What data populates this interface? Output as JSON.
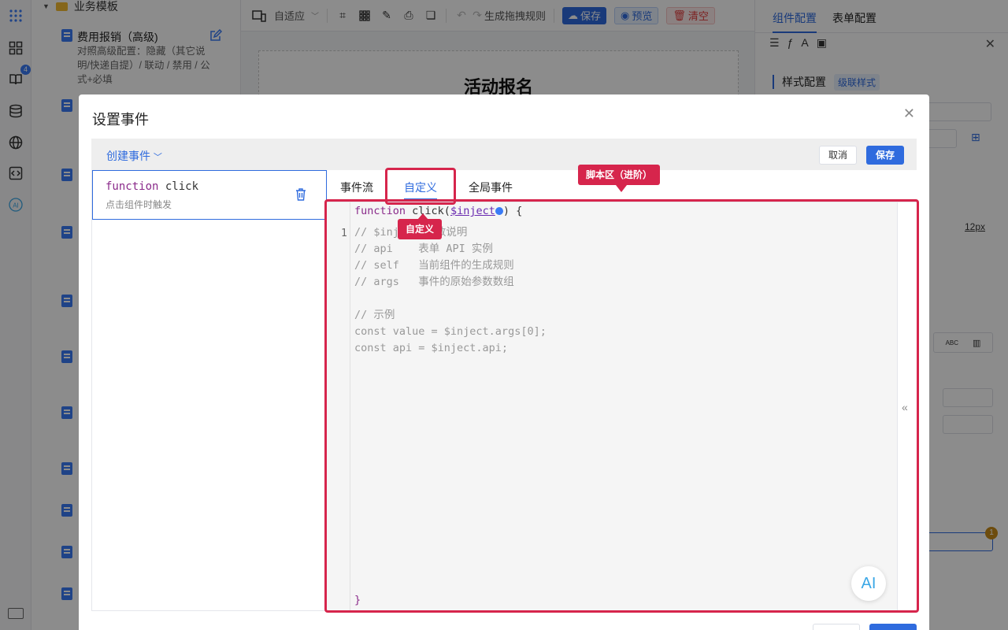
{
  "tree": {
    "root_label": "业务模板",
    "item_title": "费用报销（高级)",
    "item_desc": "对照高级配置：隐藏（其它说明/快递自提）/ 联动 / 禁用 / 公式+必填"
  },
  "rail": {
    "badge_count": "4",
    "ai_label": "AI"
  },
  "toolbar": {
    "mode_label": "自适应",
    "rules_label": "生成拖拽规则",
    "save_label": "保存",
    "preview_label": "预览",
    "clear_label": "清空"
  },
  "canvas": {
    "form_title": "活动报名"
  },
  "config": {
    "tab_component": "组件配置",
    "tab_form": "表单配置",
    "section_style": "样式配置",
    "cascade_style": "级联样式",
    "px_value": "12px",
    "abc_label": "ABC",
    "warn_count": "1"
  },
  "modal": {
    "title": "设置事件",
    "create_event": "创建事件",
    "cancel": "取消",
    "save": "保存",
    "event": {
      "keyword": "function",
      "name": "click",
      "desc": "点击组件时触发"
    },
    "tabs": [
      "事件流",
      "自定义",
      "全局事件"
    ],
    "gutter_line": "1",
    "code": {
      "header_kw": "function",
      "header_name": " click(",
      "header_arg": "$inject",
      "header_tail": ") {",
      "lines": [
        "// $inject 参数说明",
        "// api    表单 API 实例",
        "// self   当前组件的生成规则",
        "// args   事件的原始参数数组",
        "",
        "// 示例",
        "const value = $inject.args[0];",
        "const api = $inject.api;"
      ],
      "footer": "}"
    },
    "ai_label": "AI"
  },
  "annotations": {
    "custom_tag": "自定义",
    "script_tag": "脚本区（进阶）"
  },
  "colors": {
    "primary": "#2f6bde",
    "annotation": "#d6254c",
    "danger": "#e23c3c"
  }
}
